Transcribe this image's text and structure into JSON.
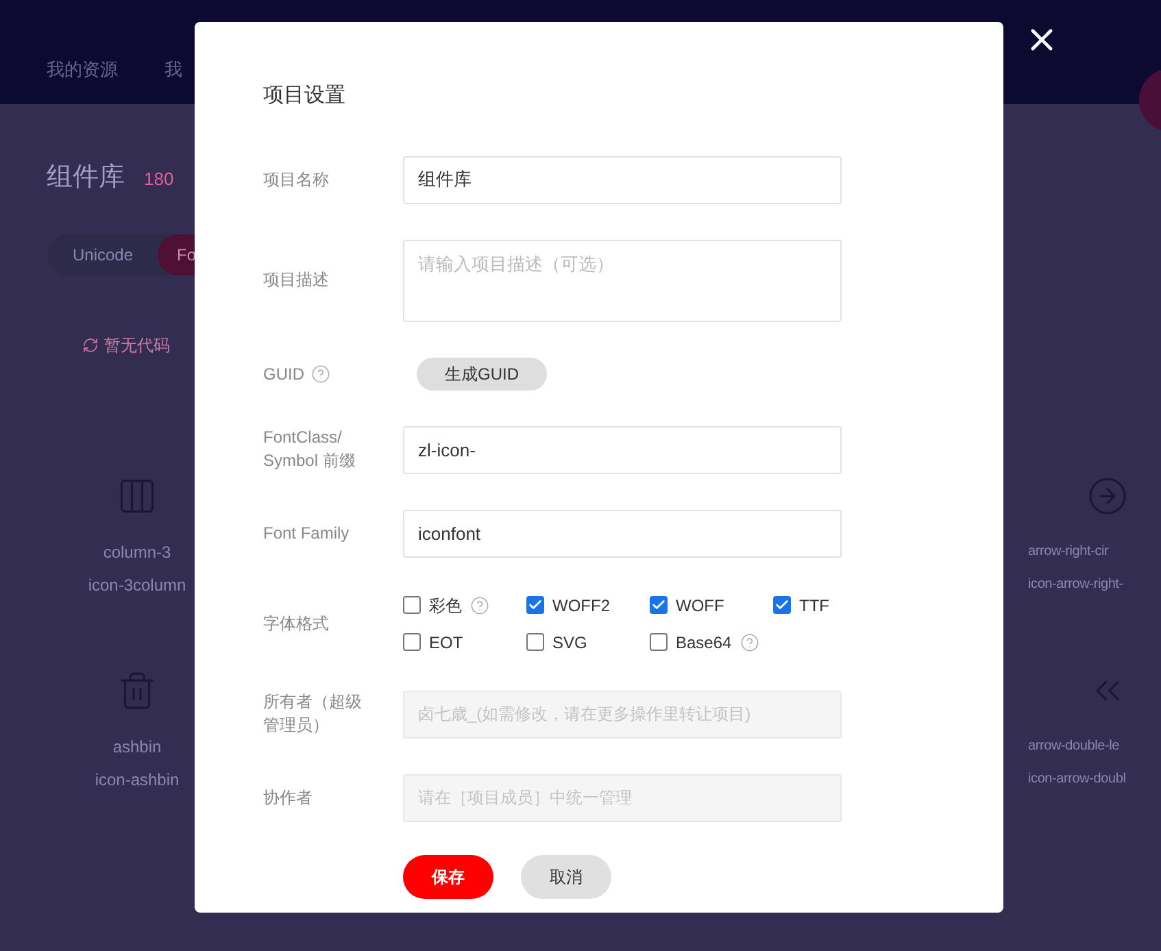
{
  "header": {
    "nav_items": [
      "我的资源",
      "我"
    ]
  },
  "library": {
    "title": "组件库",
    "count": "180",
    "tabs": [
      {
        "label": "Unicode",
        "selected": false
      },
      {
        "label": "Fo",
        "selected": true
      }
    ],
    "code_link": "暂无代码"
  },
  "icons": [
    {
      "kind": "columns",
      "name": "column-3",
      "class": "icon-3column"
    },
    {
      "kind": "arrow-circle",
      "name": "arrow-right-cir",
      "class": "icon-arrow-right-"
    },
    {
      "kind": "trash",
      "name": "ashbin",
      "class": "icon-ashbin"
    },
    {
      "kind": "double-left",
      "name": "arrow-double-le",
      "class": "icon-arrow-doubl"
    }
  ],
  "dialog": {
    "title": "项目设置",
    "fields": [
      {
        "kind": "text",
        "label": "项目名称",
        "value": "组件库"
      },
      {
        "kind": "textarea",
        "label": "项目描述",
        "placeholder": "请输入项目描述（可选）"
      },
      {
        "kind": "button",
        "label": "GUID",
        "help": true,
        "button": "生成GUID"
      },
      {
        "kind": "text",
        "label": "FontClass/ Symbol 前缀",
        "value": "zl-icon-"
      },
      {
        "kind": "text",
        "label": "Font Family",
        "value": "iconfont"
      },
      {
        "kind": "checkboxes",
        "label": "字体格式",
        "options": [
          {
            "label": "彩色",
            "checked": false,
            "help": true
          },
          {
            "label": "WOFF2",
            "checked": true,
            "help": false
          },
          {
            "label": "WOFF",
            "checked": true,
            "help": false
          },
          {
            "label": "TTF",
            "checked": true,
            "help": false
          },
          {
            "label": "EOT",
            "checked": false,
            "help": false
          },
          {
            "label": "SVG",
            "checked": false,
            "help": false
          },
          {
            "label": "Base64",
            "checked": false,
            "help": true
          }
        ]
      },
      {
        "kind": "disabled",
        "label": "所有者（超级管理员）",
        "placeholder": "卤七歳_(如需修改，请在更多操作里转让项目)"
      },
      {
        "kind": "disabled",
        "label": "协作者",
        "placeholder": "请在［项目成员］中统一管理"
      }
    ],
    "buttons": [
      {
        "label": "保存",
        "kind": "primary"
      },
      {
        "label": "取消",
        "kind": "secondary"
      }
    ]
  }
}
